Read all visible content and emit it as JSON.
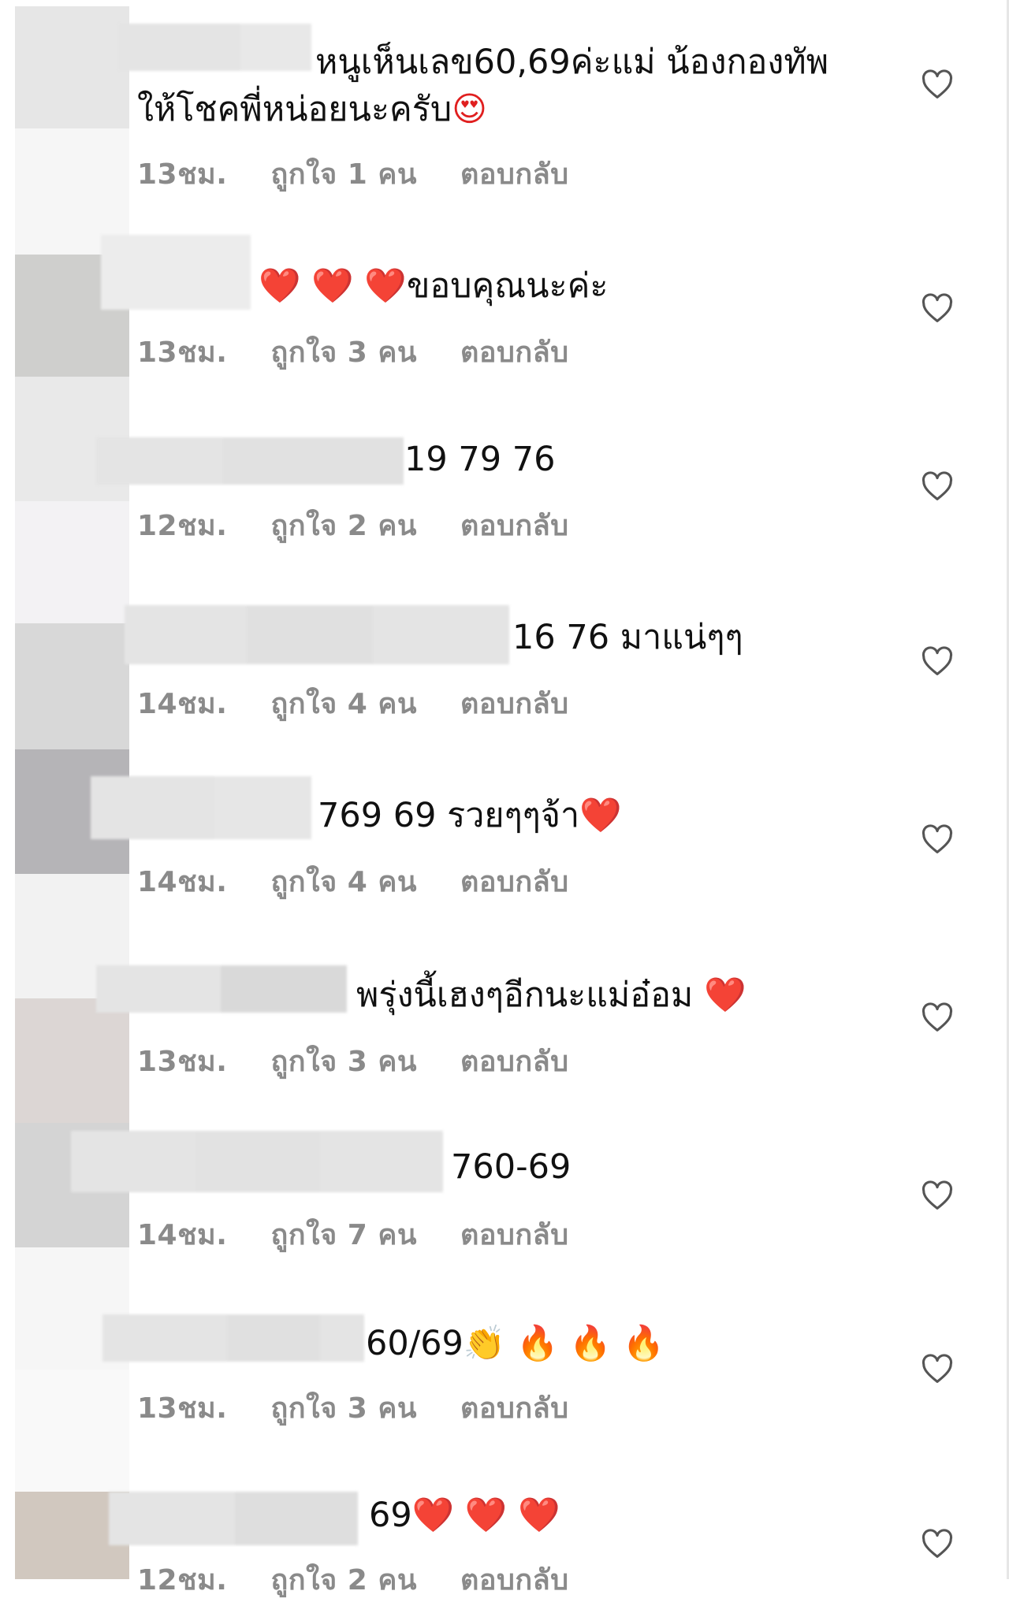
{
  "comments": [
    {
      "text_line1": "หนูเห็นเลข60,69ค่ะแม่ น้องกองทัพ",
      "text_line2": "ให้โชคพี่หน่อยนะครับ",
      "emoji": "😍",
      "time": "13ชม.",
      "likes": "ถูกใจ 1 คน",
      "reply": "ตอบกลับ"
    },
    {
      "text": "ขอบคุณนะค่ะ",
      "emoji_prefix": "❤️ ❤️ ❤️",
      "time": "13ชม.",
      "likes": "ถูกใจ 3 คน",
      "reply": "ตอบกลับ"
    },
    {
      "text": "19 79 76",
      "time": "12ชม.",
      "likes": "ถูกใจ 2 คน",
      "reply": "ตอบกลับ"
    },
    {
      "text": "16 76 มาแน่ๆๆ",
      "time": "14ชม.",
      "likes": "ถูกใจ 4 คน",
      "reply": "ตอบกลับ"
    },
    {
      "text": "769 69 รวยๆๆจ้า",
      "emoji": "❤️",
      "time": "14ชม.",
      "likes": "ถูกใจ 4 คน",
      "reply": "ตอบกลับ"
    },
    {
      "text": "พรุ่งนี้เฮงๆอีกนะแม่อ๋อม",
      "emoji": "❤️",
      "time": "13ชม.",
      "likes": "ถูกใจ 3 คน",
      "reply": "ตอบกลับ"
    },
    {
      "text": "760-69",
      "time": "14ชม.",
      "likes": "ถูกใจ 7 คน",
      "reply": "ตอบกลับ"
    },
    {
      "text": "60/69",
      "emoji": "👏 🔥 🔥 🔥",
      "time": "13ชม.",
      "likes": "ถูกใจ 3 คน",
      "reply": "ตอบกลับ"
    },
    {
      "text": "69",
      "emoji": "❤️ ❤️ ❤️",
      "time": "12ชม.",
      "likes": "ถูกใจ 2 คน",
      "reply": "ตอบกลับ"
    }
  ],
  "colors": {
    "meta_text": "#8a8a8a",
    "heart_emoji": "#e01f1f",
    "heart_icon_stroke": "#555555"
  },
  "icons": {
    "like": "heart-outline-icon"
  }
}
